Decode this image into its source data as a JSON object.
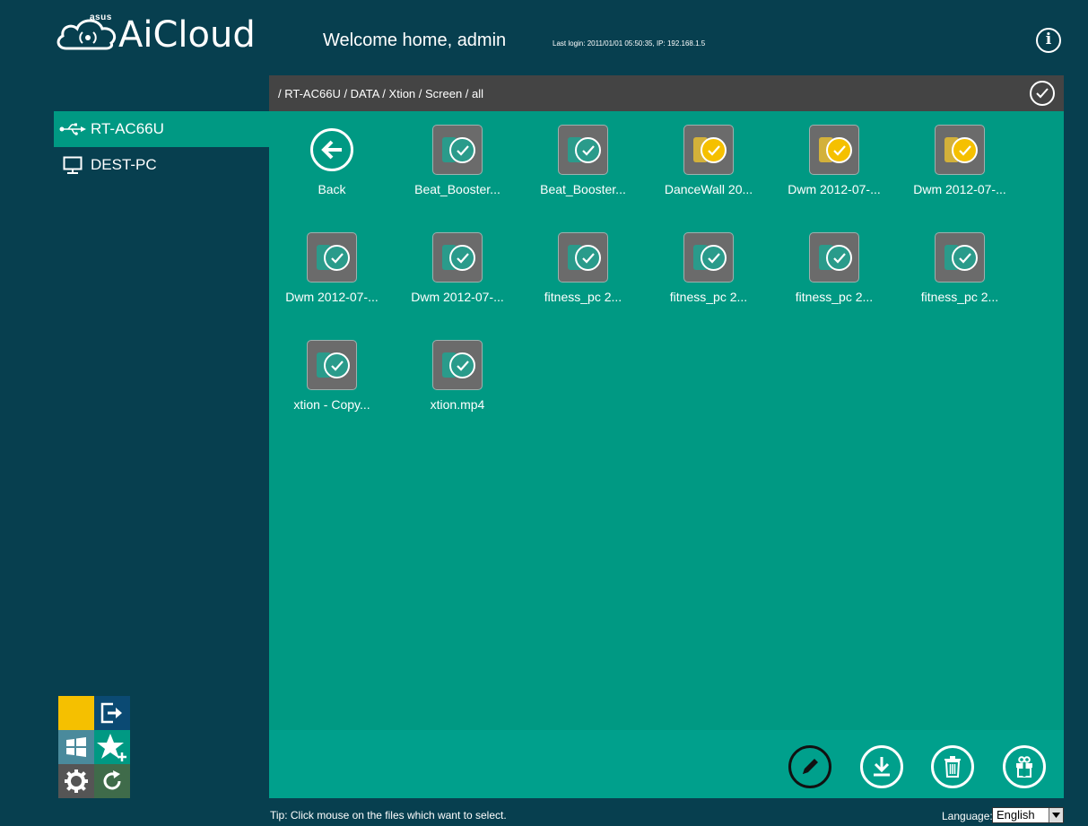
{
  "header": {
    "logo_text": "AiCloud",
    "brand_mark": "asus",
    "welcome": "Welcome home, admin",
    "last_login": "Last login: 2011/01/01 05:50:35, IP: 192.168.1.5"
  },
  "sidebar": {
    "items": [
      {
        "label": "RT-AC66U",
        "icon": "usb-icon",
        "active": true
      },
      {
        "label": "DEST-PC",
        "icon": "monitor-icon",
        "active": false
      }
    ]
  },
  "path": "/ RT-AC66U / DATA / Xtion / Screen / all",
  "files": [
    {
      "name": "Back",
      "type": "back"
    },
    {
      "name": "Beat_Booster...",
      "selected": false
    },
    {
      "name": "Beat_Booster...",
      "selected": false
    },
    {
      "name": "DanceWall 20...",
      "selected": true
    },
    {
      "name": "Dwm 2012-07-...",
      "selected": true
    },
    {
      "name": "Dwm 2012-07-...",
      "selected": true
    },
    {
      "name": "Dwm 2012-07-...",
      "selected": false
    },
    {
      "name": "Dwm 2012-07-...",
      "selected": false
    },
    {
      "name": "fitness_pc 2...",
      "selected": false
    },
    {
      "name": "fitness_pc 2...",
      "selected": false
    },
    {
      "name": "fitness_pc 2...",
      "selected": false
    },
    {
      "name": "fitness_pc 2...",
      "selected": false
    },
    {
      "name": "xtion - Copy...",
      "selected": false
    },
    {
      "name": "xtion.mp4",
      "selected": false
    }
  ],
  "toolbar": [
    "pencil-icon",
    "download-icon",
    "trash-icon",
    "gift-icon"
  ],
  "footer": {
    "tip": "Tip: Click mouse on the files which want to select.",
    "language_label": "Language:",
    "language_value": "English"
  },
  "colors": {
    "background": "#073f4f",
    "accent": "#009983",
    "selected": "#f5c000",
    "pathbar": "#444444"
  }
}
